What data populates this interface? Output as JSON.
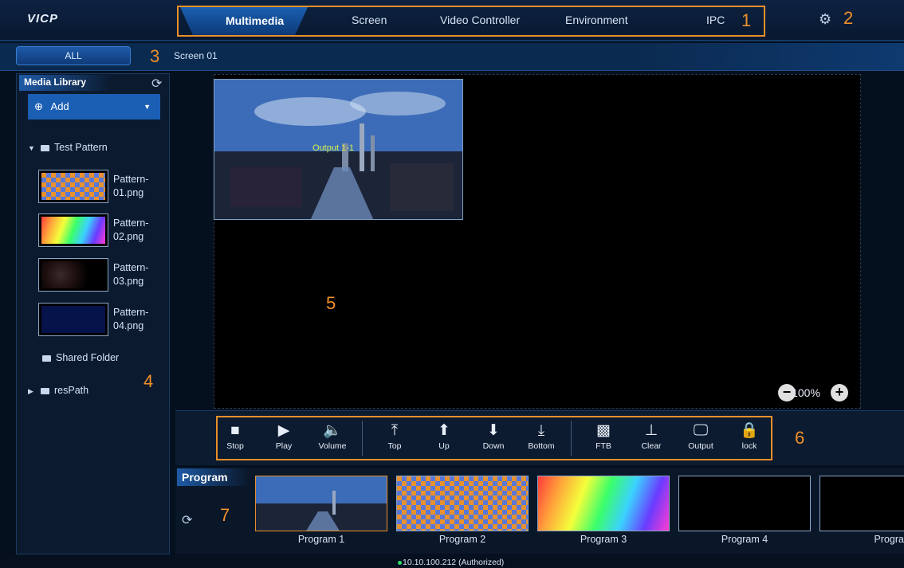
{
  "app": {
    "logo": "VICP"
  },
  "top_nav": {
    "tabs": [
      {
        "label": "Multimedia",
        "active": true
      },
      {
        "label": "Screen"
      },
      {
        "label": "Video Controller"
      },
      {
        "label": "Environment"
      },
      {
        "label": "IPC"
      }
    ],
    "callout_1": "1",
    "callout_2": "2"
  },
  "screen_bar": {
    "all_label": "ALL",
    "callout_3": "3",
    "screen_name": "Screen 01"
  },
  "media_library": {
    "title": "Media Library",
    "add_label": "Add",
    "folders": {
      "test_pattern": "Test Pattern",
      "shared_folder": "Shared Folder",
      "res_path": "resPath"
    },
    "files": [
      {
        "line1": "Pattern-",
        "line2": "01.png"
      },
      {
        "line1": "Pattern-",
        "line2": "02.png"
      },
      {
        "line1": "Pattern-",
        "line2": "03.png"
      },
      {
        "line1": "Pattern-",
        "line2": "04.png"
      }
    ],
    "callout_4": "4"
  },
  "preview": {
    "output_label": "Output 1-1",
    "callout_5": "5",
    "zoom_level": "100%"
  },
  "toolbar": {
    "buttons": [
      {
        "label": "Stop"
      },
      {
        "label": "Play"
      },
      {
        "label": "Volume"
      },
      {
        "label": "Top"
      },
      {
        "label": "Up"
      },
      {
        "label": "Down"
      },
      {
        "label": "Bottom"
      },
      {
        "label": "FTB"
      },
      {
        "label": "Clear"
      },
      {
        "label": "Output"
      },
      {
        "label": "lock"
      }
    ],
    "callout_6": "6"
  },
  "program": {
    "title": "Program",
    "callout_7": "7",
    "items": [
      {
        "label": "Program 1"
      },
      {
        "label": "Program 2"
      },
      {
        "label": "Program 3"
      },
      {
        "label": "Program 4"
      },
      {
        "label": "Progra"
      }
    ]
  },
  "status": {
    "text": "10.10.100.212 (Authorized)"
  },
  "colors": {
    "accent": "#1b5fb5",
    "callout": "#e8902a",
    "background": "#05101f"
  }
}
